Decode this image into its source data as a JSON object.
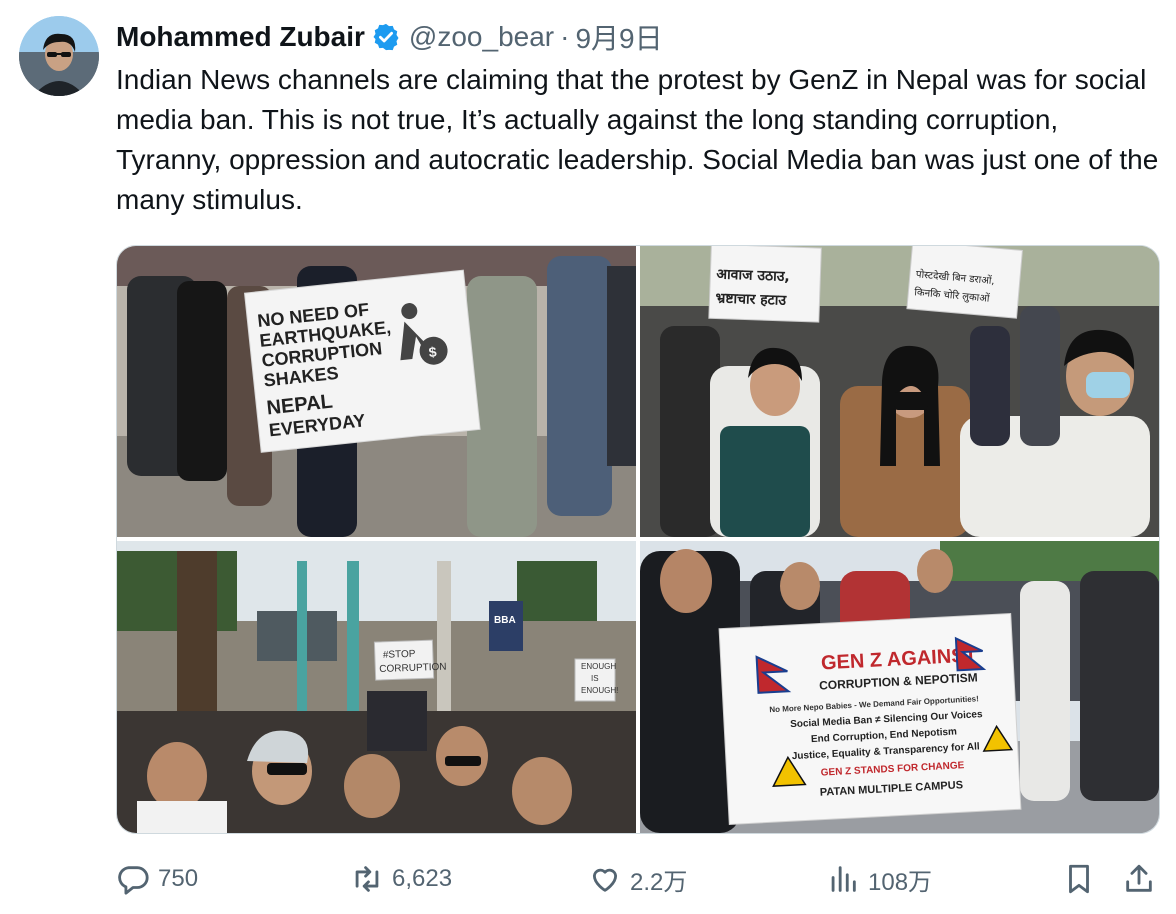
{
  "author": {
    "name": "Mohammed Zubair",
    "handle": "@zoo_bear",
    "separator": "·",
    "date": "9月9日",
    "verified_icon": "verified-badge-icon"
  },
  "tweet": {
    "text": "Indian News channels are claiming that the protest by GenZ in Nepal was for social media ban. This is not true, It’s actually against the long standing corruption, Tyranny, oppression and autocratic leadership. Social Media ban was just one of the many stimulus."
  },
  "photos": {
    "p1": {
      "sign_lines": [
        "NO NEED OF",
        "EARTHQUAKE,",
        "CORRUPTION",
        "SHAKES",
        "NEPAL",
        "EVERYDAY"
      ]
    },
    "p2": {
      "sign_left": [
        "आवाज उठाउ,",
        "भ्रष्टाचार हटाउ"
      ],
      "sign_right": [
        "पोस्टदेखी बिन डराओं,",
        "किनकि चोरि लुकाओं"
      ]
    },
    "p3": {
      "sign_left": [
        "#STOP",
        "CORRUPTION"
      ],
      "sign_right": [
        "ENOUGH",
        "IS",
        "ENOUGH!"
      ],
      "store_sign": "BBA"
    },
    "p4": {
      "banner_title": "GEN Z AGAINST",
      "banner_sub": "CORRUPTION & NEPOTISM",
      "banner_lines": [
        "No More Nepo Babies - We Demand Fair Opportunities!",
        "Social Media Ban ≠ Silencing Our Voices",
        "End Corruption, End Nepotism",
        "Justice, Equality & Transparency for All"
      ],
      "banner_red": "GEN Z STANDS FOR CHANGE",
      "banner_bottom": "PATAN MULTIPLE CAMPUS"
    }
  },
  "actions": {
    "reply": {
      "icon": "reply-icon",
      "count": "750"
    },
    "retweet": {
      "icon": "retweet-icon",
      "count": "6,623"
    },
    "like": {
      "icon": "heart-icon",
      "count": "2.2万"
    },
    "views": {
      "icon": "views-icon",
      "count": "108万"
    },
    "bookmark": {
      "icon": "bookmark-icon"
    },
    "share": {
      "icon": "share-icon"
    }
  },
  "colors": {
    "text": "#0f1419",
    "secondary": "#536471",
    "verified": "#1d9bf0",
    "border": "#cfd9de"
  }
}
